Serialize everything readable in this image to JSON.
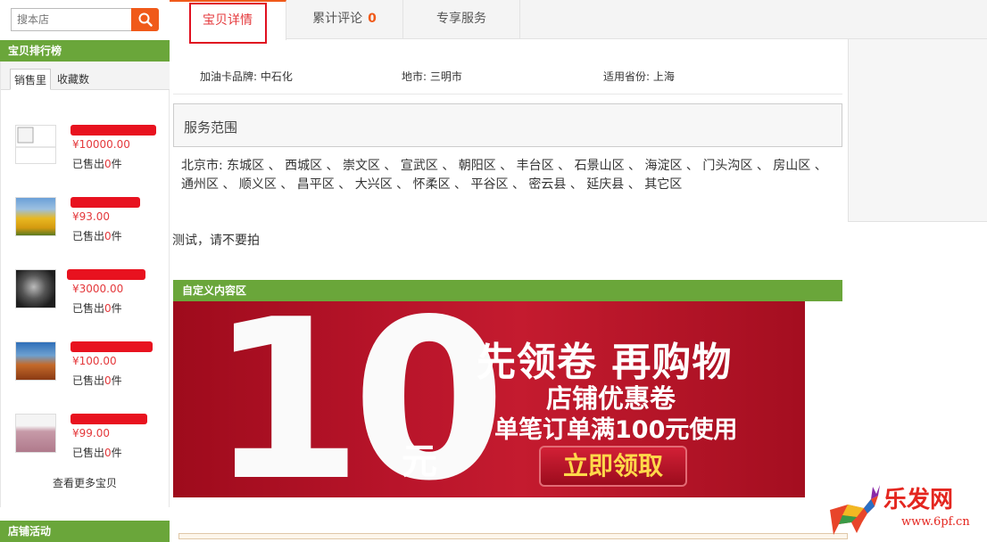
{
  "search": {
    "placeholder": "搜本店",
    "button_icon": "search-icon"
  },
  "sidebar": {
    "ranking_title": "宝贝排行榜",
    "tabs": [
      {
        "label": "销售里"
      },
      {
        "label": "收藏数"
      }
    ],
    "products": [
      {
        "price": "¥10000.00",
        "sold_prefix": "已售出",
        "sold_count": "0",
        "sold_suffix": "件"
      },
      {
        "price": "¥93.00",
        "sold_prefix": "已售出",
        "sold_count": "0",
        "sold_suffix": "件"
      },
      {
        "price": "¥3000.00",
        "sold_prefix": "已售出",
        "sold_count": "0",
        "sold_suffix": "件"
      },
      {
        "price": "¥100.00",
        "sold_prefix": "已售出",
        "sold_count": "0",
        "sold_suffix": "件"
      },
      {
        "price": "¥99.00",
        "sold_prefix": "已售出",
        "sold_count": "0",
        "sold_suffix": "件"
      }
    ],
    "more_link": "查看更多宝贝",
    "activity_title": "店铺活动"
  },
  "tabs": {
    "details": "宝贝详情",
    "reviews": "累计评论",
    "reviews_count": "0",
    "service": "专享服务"
  },
  "attributes": {
    "brand": "加油卡品牌: 中石化",
    "city": "地市: 三明市",
    "province": "适用省份: 上海"
  },
  "service": {
    "title": "服务范围",
    "text": "北京市:  东城区 、 西城区 、 崇文区 、 宣武区 、 朝阳区 、 丰台区 、 石景山区 、 海淀区 、 门头沟区 、 房山区 、 通州区 、 顺义区 、 昌平区 、 大兴区 、 怀柔区 、 平谷区 、 密云县 、 延庆县 、 其它区"
  },
  "note": "测试，请不要拍",
  "custom_area": {
    "title": "自定义内容区",
    "banner": {
      "big_number": "10",
      "unit": "元",
      "line1": "先领卷 再购物",
      "line2": "店铺优惠卷",
      "line3": "单笔订单满100元使用",
      "button": "立即领取"
    }
  },
  "watermark": {
    "brand": "乐发网",
    "url": "www.6pf.cn"
  },
  "colors": {
    "green": "#6aa63a",
    "accent": "#f05a1a",
    "red": "#e4393c",
    "redaction": "#e8121f"
  }
}
